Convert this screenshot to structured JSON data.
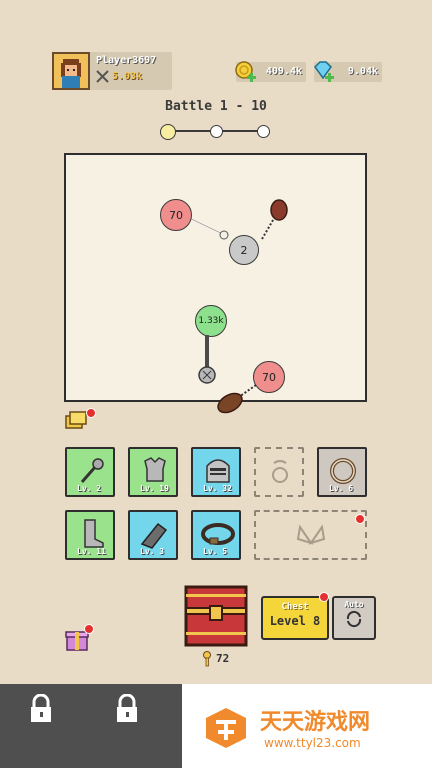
{
  "player": {
    "name": "Player3697",
    "power": "5.03k"
  },
  "currency": {
    "gold": "409.4k",
    "gems": "9.04k"
  },
  "battle": {
    "title": "Battle 1 - 10",
    "stage_progress": {
      "total_markers": 3,
      "current_marker": 1
    }
  },
  "arena": {
    "balls": [
      {
        "label": "70",
        "color": "#f08e8e"
      },
      {
        "label": "2",
        "color": "#c9c9c9"
      },
      {
        "label": "1.33k",
        "color": "#8de08c"
      },
      {
        "label": "70",
        "color": "#f08e8e"
      }
    ]
  },
  "inventory": {
    "row1": [
      {
        "item": "mace",
        "level": "Lv. 2",
        "color": "green"
      },
      {
        "item": "chest-armor",
        "level": "Lv. 19",
        "color": "green"
      },
      {
        "item": "knight-helmet",
        "level": "Lv. 32",
        "color": "cyan"
      },
      {
        "item": "amulet-slot",
        "level": "",
        "color": "empty"
      },
      {
        "item": "ring",
        "level": "Lv. 6",
        "color": "gray"
      }
    ],
    "row2": [
      {
        "item": "boot",
        "level": "Lv. 11",
        "color": "green"
      },
      {
        "item": "gauntlet",
        "level": "Lv. 3",
        "color": "cyan"
      },
      {
        "item": "belt",
        "level": "Lv. 5",
        "color": "cyan"
      },
      {
        "item": "wings-slot",
        "level": "",
        "color": "empty"
      }
    ]
  },
  "chest": {
    "keys": "72",
    "button_title": "Chest",
    "button_level": "Level 8",
    "auto_label": "Auto"
  },
  "watermark": {
    "title": "天天游戏网",
    "url": "www.ttyl23.com"
  },
  "colors": {
    "background": "#e8dcc6",
    "chest_yellow": "#f4d63b",
    "alert_red": "#e53030"
  }
}
